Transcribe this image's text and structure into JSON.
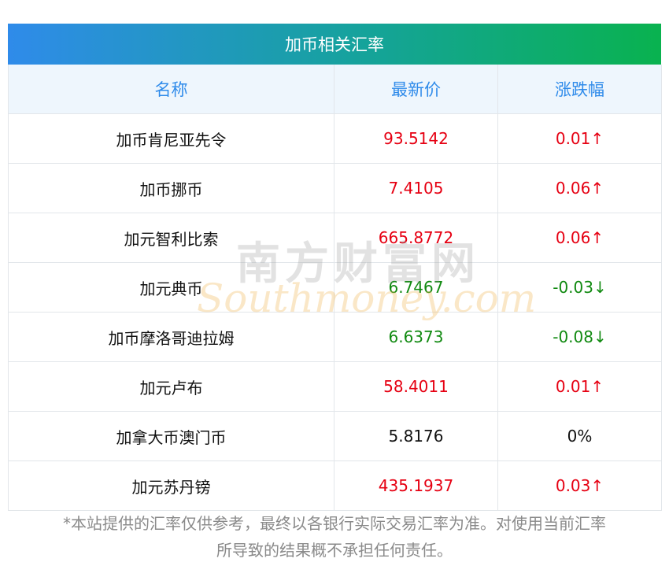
{
  "title": "加币相关汇率",
  "headers": [
    "名称",
    "最新价",
    "涨跌幅"
  ],
  "rows": [
    {
      "name": "加币肯尼亚先令",
      "price": "93.5142",
      "change": "0.01↑",
      "trend": "up"
    },
    {
      "name": "加币挪币",
      "price": "7.4105",
      "change": "0.06↑",
      "trend": "up"
    },
    {
      "name": "加元智利比索",
      "price": "665.8772",
      "change": "0.06↑",
      "trend": "up"
    },
    {
      "name": "加元典币",
      "price": "6.7467",
      "change": "-0.03↓",
      "trend": "down"
    },
    {
      "name": "加币摩洛哥迪拉姆",
      "price": "6.6373",
      "change": "-0.08↓",
      "trend": "down"
    },
    {
      "name": "加元卢布",
      "price": "58.4011",
      "change": "0.01↑",
      "trend": "up"
    },
    {
      "name": "加拿大币澳门币",
      "price": "5.8176",
      "change": "0%",
      "trend": "flat"
    },
    {
      "name": "加元苏丹镑",
      "price": "435.1937",
      "change": "0.03↑",
      "trend": "up"
    }
  ],
  "watermark": {
    "cn": "南方财富网",
    "en": "Southmoney.com"
  },
  "footer": {
    "line1": "*本站提供的汇率仅供参考，最终以各银行实际交易汇率为准。对使用当前汇率",
    "line2": "所导致的结果概不承担任何责任。"
  },
  "colors": {
    "up": "#e60012",
    "down": "#118a11",
    "header_text": "#2f8bea"
  }
}
